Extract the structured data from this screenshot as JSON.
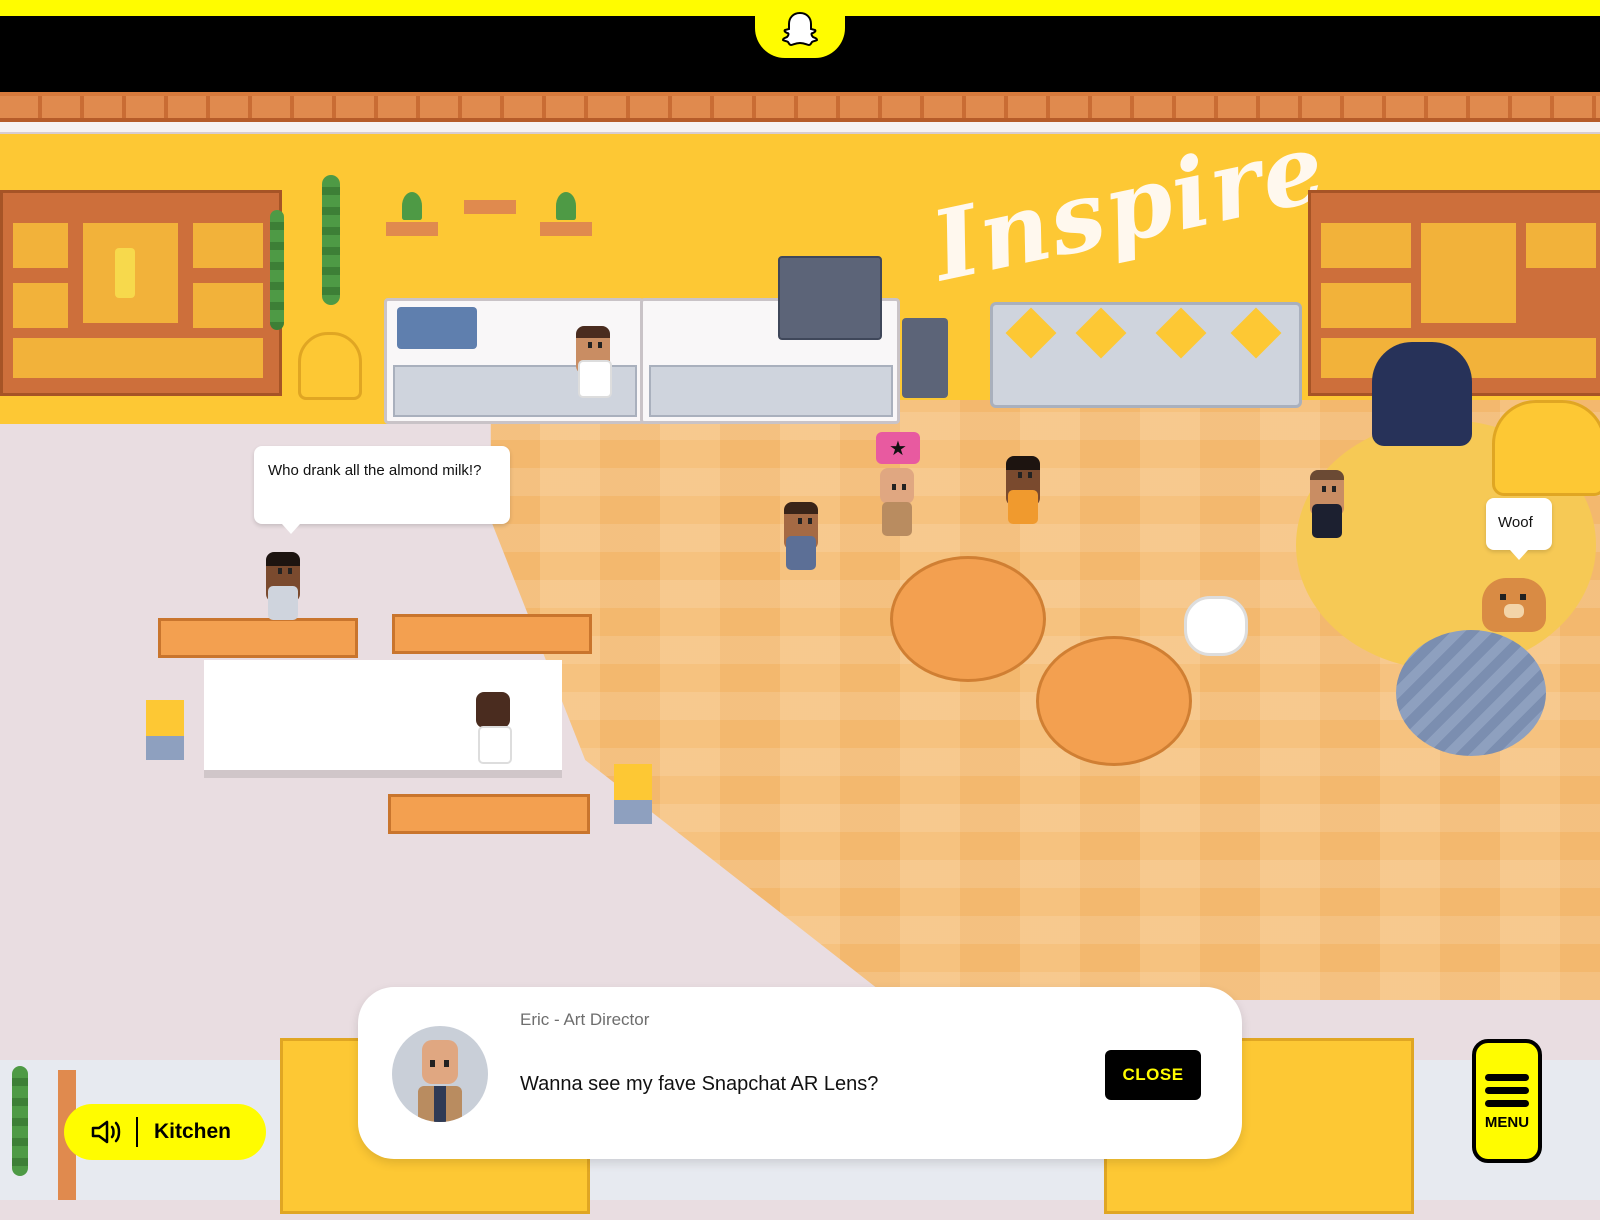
{
  "scene": {
    "wall_sign": "Inspire",
    "room_name": "Kitchen"
  },
  "bubbles": {
    "almond": "Who drank all the almond milk!?",
    "dog": "Woof"
  },
  "dialog": {
    "speaker": "Eric - Art Director",
    "message": "Wanna see my fave Snapchat AR Lens?",
    "close_label": "CLOSE"
  },
  "menu": {
    "label": "MENU"
  },
  "colors": {
    "snap_yellow": "#fffc00",
    "wall_yellow": "#fdc834",
    "floor_purple": "#e9dde1",
    "wood": "#f3a050"
  },
  "icons": {
    "logo": "snapchat-ghost-icon",
    "sound": "speaker-icon",
    "menu": "hamburger-icon",
    "badge": "star-icon"
  }
}
